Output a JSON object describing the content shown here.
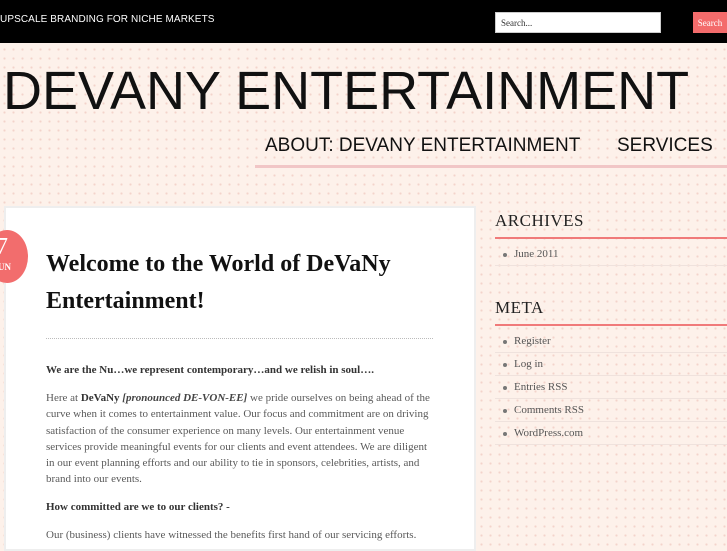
{
  "header": {
    "tagline": "UPSCALE BRANDING FOR NICHE MARKETS",
    "search": {
      "placeholder": "Search...",
      "button_label": "Search"
    }
  },
  "site": {
    "title": "DEVANY ENTERTAINMENT",
    "nav": [
      "ABOUT: DEVANY ENTERTAINMENT",
      "SERVICES"
    ]
  },
  "post": {
    "date_day": "7",
    "date_month": "UN",
    "title": "Welcome to the World of DeVaNy Entertainment!",
    "intro": "We are the Nu…we represent contemporary…and we relish in soul….",
    "para1_prefix": "Here at ",
    "para1_brand": "DeVaNy",
    "para1_pronounce": "[pronounced DE-VON-EE]",
    "para1_rest": " we pride ourselves on being ahead of the curve when it comes to entertainment value. Our focus and commitment are on driving satisfaction of the consumer experience on many levels. Our entertainment venue services provide meaningful events for our clients and event attendees. We are diligent in our event planning efforts and our ability to tie in sponsors, celebrities, artists, and brand into our events.",
    "question": "How committed are we to our clients? -",
    "para2": "Our (business) clients have witnessed the benefits first hand of our servicing efforts."
  },
  "sidebar": {
    "archives_title": "ARCHIVES",
    "archives": [
      "June 2011"
    ],
    "meta_title": "META",
    "meta": [
      "Register",
      "Log in",
      "Entries RSS",
      "Comments RSS",
      "WordPress.com"
    ]
  },
  "colors": {
    "accent": "#f36b6b",
    "topbar": "#000000",
    "background": "#fdf1ea"
  }
}
